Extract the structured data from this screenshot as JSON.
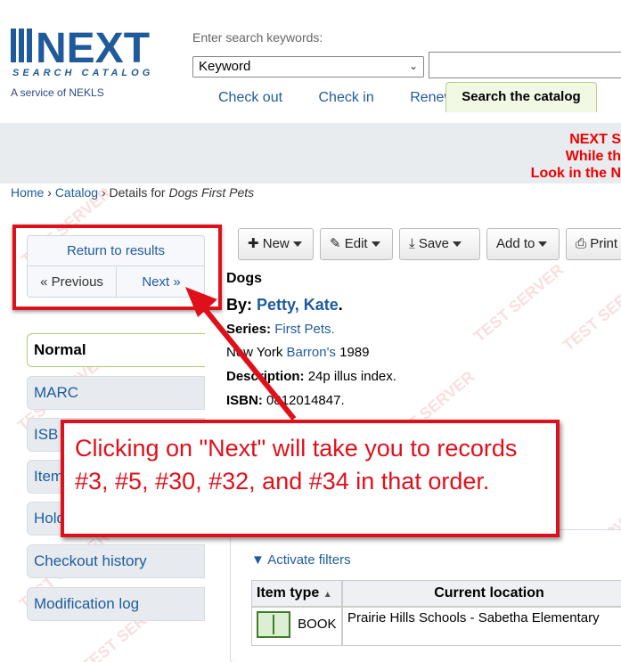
{
  "header": {
    "logo_text": "NEXT",
    "logo_subtitle": "SEARCH CATALOG",
    "service_text": "A service of NEKLS",
    "search_prompt": "Enter search keywords:",
    "search_type": "Keyword",
    "nav": [
      "Check out",
      "Check in",
      "Renew"
    ],
    "active_tab": "Search the catalog"
  },
  "alert": {
    "lines": [
      "NEXT S",
      "While th",
      "Look in the N"
    ]
  },
  "breadcrumb": {
    "home": "Home",
    "catalog": "Catalog",
    "details_prefix": "Details for",
    "title": "Dogs First Pets"
  },
  "results_nav": {
    "return": "Return to results",
    "previous": "« Previous",
    "next": "Next »"
  },
  "left_menu": [
    "Normal",
    "MARC",
    "ISB",
    "Item",
    "Hold",
    "Checkout history",
    "Modification log"
  ],
  "toolbar": {
    "new": "New",
    "edit": "Edit",
    "save": "Save",
    "add_to": "Add to",
    "print": "Print"
  },
  "record": {
    "title": "Dogs",
    "by_label": "By:",
    "author": "Petty, Kate",
    "series_label": "Series:",
    "series": "First Pets.",
    "pub_place": "New York",
    "publisher": "Barron's",
    "year": "1989",
    "description_label": "Description:",
    "description": "24p illus index.",
    "isbn_label": "ISBN:",
    "isbn": "0812014847."
  },
  "callout": {
    "text": "Clicking on \"Next\" will take you to records #3, #5, #30, #32, and #34 in that order."
  },
  "holdings": {
    "filters_label": "Activate filters",
    "headers": [
      "Item type",
      "Current location"
    ],
    "rows": [
      {
        "item_type": "BOOK",
        "location": "Prairie Hills Schools - Sabetha Elementary"
      }
    ]
  },
  "watermark_text": "TEST SERVER",
  "colors": {
    "brand_blue": "#1f5b9c",
    "alert_red": "#e00000",
    "callout_red": "#e0101a"
  }
}
